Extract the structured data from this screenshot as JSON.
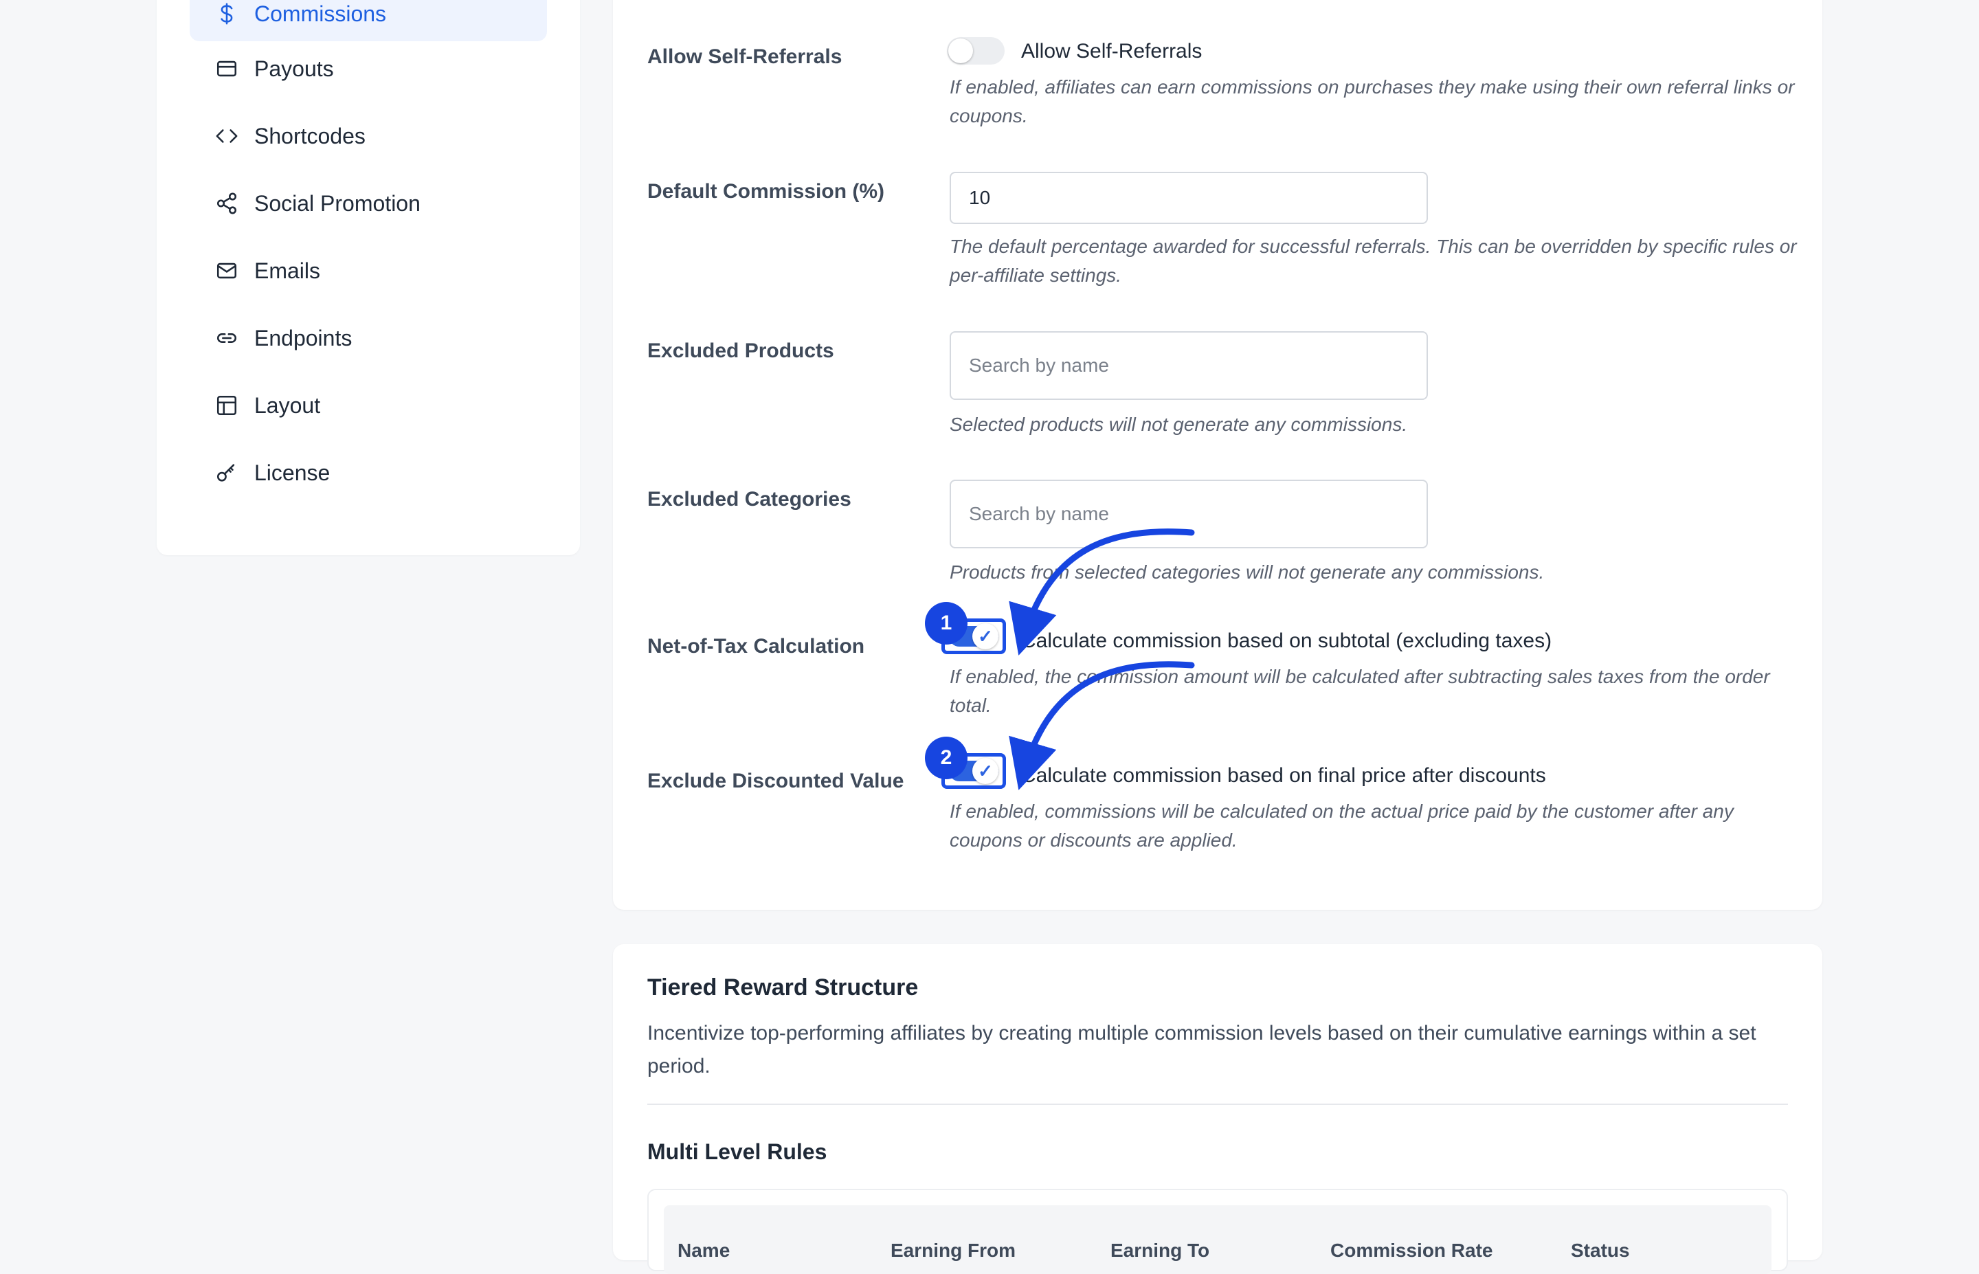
{
  "sidebar": {
    "items": [
      {
        "label": "Commissions",
        "icon": "dollar-icon",
        "active": true
      },
      {
        "label": "Payouts",
        "icon": "credit-card-icon"
      },
      {
        "label": "Shortcodes",
        "icon": "code-icon"
      },
      {
        "label": "Social Promotion",
        "icon": "share-icon"
      },
      {
        "label": "Emails",
        "icon": "mail-icon"
      },
      {
        "label": "Endpoints",
        "icon": "link-icon"
      },
      {
        "label": "Layout",
        "icon": "layout-icon"
      },
      {
        "label": "License",
        "icon": "key-icon"
      }
    ]
  },
  "settings": {
    "self_referrals": {
      "label": "Allow Self-Referrals",
      "toggle_label": "Allow Self-Referrals",
      "enabled": false,
      "description": "If enabled, affiliates can earn commissions on purchases they make using their own referral links or coupons."
    },
    "default_commission": {
      "label": "Default Commission (%)",
      "value": "10",
      "description": "The default percentage awarded for successful referrals. This can be overridden by specific rules or per-affiliate settings."
    },
    "excluded_products": {
      "label": "Excluded Products",
      "placeholder": "Search by name",
      "description": "Selected products will not generate any commissions."
    },
    "excluded_categories": {
      "label": "Excluded Categories",
      "placeholder": "Search by name",
      "description": "Products from selected categories will not generate any commissions."
    },
    "net_of_tax": {
      "label": "Net-of-Tax Calculation",
      "toggle_label": "Calculate commission based on subtotal (excluding taxes)",
      "enabled": true,
      "badge": "1",
      "description": "If enabled, the commission amount will be calculated after subtracting sales taxes from the order total."
    },
    "exclude_discounted": {
      "label": "Exclude Discounted Value",
      "toggle_label": "Calculate commission based on final price after discounts",
      "enabled": true,
      "badge": "2",
      "description": "If enabled, commissions will be calculated on the actual price paid by the customer after any coupons or discounts are applied."
    }
  },
  "tiered": {
    "title": "Tiered Reward Structure",
    "description": "Incentivize top-performing affiliates by creating multiple commission levels based on their cumulative earnings within a set period.",
    "multi_level_title": "Multi Level Rules",
    "columns": [
      "Name",
      "Earning From",
      "Earning To",
      "Commission Rate",
      "Status"
    ]
  },
  "colors": {
    "accent": "#1d5fe0",
    "annotation": "#1745e0"
  }
}
